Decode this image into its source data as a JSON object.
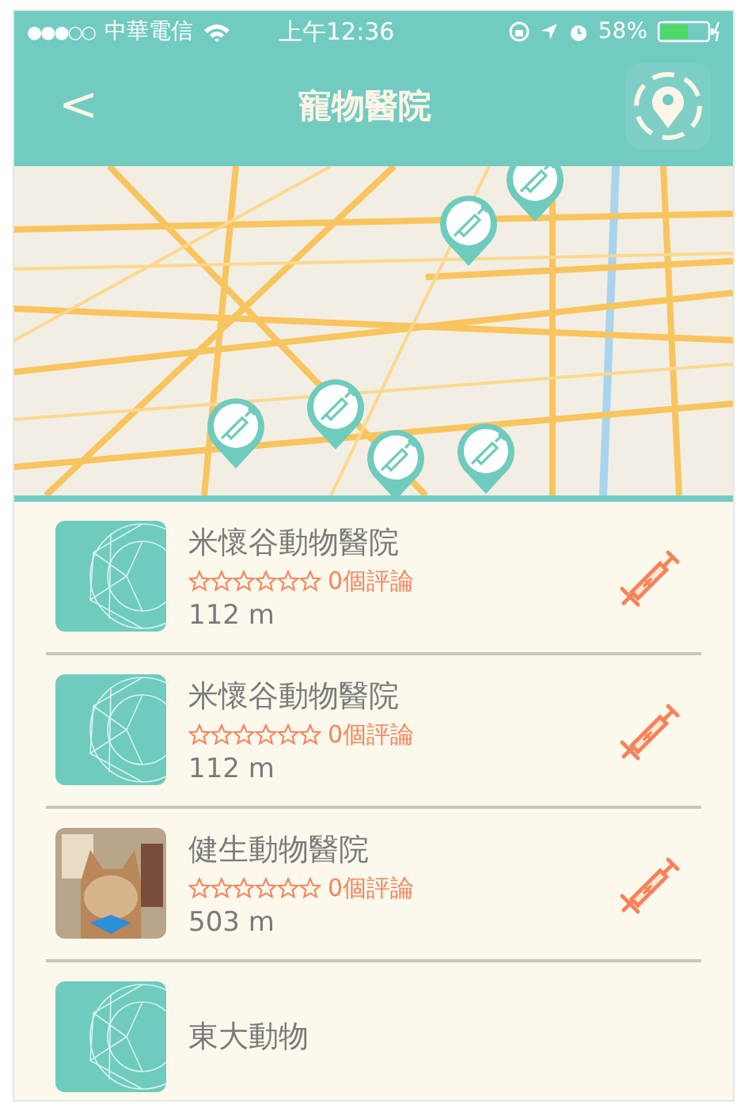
{
  "status_bar": {
    "signal": "●●●○○",
    "carrier": "中華電信",
    "time": "上午12:36",
    "battery": "58%"
  },
  "nav": {
    "title": "寵物醫院",
    "back": "<"
  },
  "clinics": [
    {
      "name": "米懷谷動物醫院",
      "stars": 0,
      "reviews": "0個評論",
      "distance": "112 m",
      "kind": "logo"
    },
    {
      "name": "米懷谷動物醫院",
      "stars": 0,
      "reviews": "0個評論",
      "distance": "112 m",
      "kind": "logo"
    },
    {
      "name": "健生動物醫院",
      "stars": 0,
      "reviews": "0個評論",
      "distance": "503 m"
    },
    {
      "name": "東大動物",
      "kind": "logo"
    }
  ]
}
